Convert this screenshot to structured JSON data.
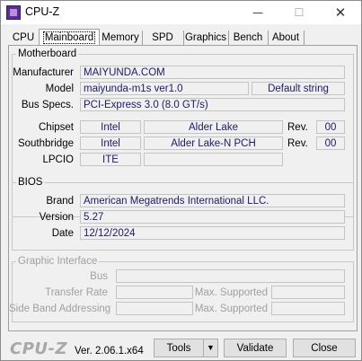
{
  "window": {
    "title": "CPU-Z"
  },
  "tabs": [
    "CPU",
    "Mainboard",
    "Memory",
    "SPD",
    "Graphics",
    "Bench",
    "About"
  ],
  "selected_tab": "Mainboard",
  "motherboard": {
    "legend": "Motherboard",
    "manufacturer_label": "Manufacturer",
    "manufacturer": "MAIYUNDA.COM",
    "model_label": "Model",
    "model": "maiyunda-m1s ver1.0",
    "model_extra": "Default string",
    "bus_label": "Bus Specs.",
    "bus": "PCI-Express 3.0 (8.0 GT/s)",
    "chipset_label": "Chipset",
    "chipset_vendor": "Intel",
    "chipset_name": "Alder Lake",
    "chipset_rev_label": "Rev.",
    "chipset_rev": "00",
    "southbridge_label": "Southbridge",
    "southbridge_vendor": "Intel",
    "southbridge_name": "Alder Lake-N PCH",
    "southbridge_rev_label": "Rev.",
    "southbridge_rev": "00",
    "lpcio_label": "LPCIO",
    "lpcio_vendor": "ITE",
    "lpcio_name": ""
  },
  "bios": {
    "legend": "BIOS",
    "brand_label": "Brand",
    "brand": "American Megatrends International LLC.",
    "version_label": "Version",
    "version": "5.27",
    "date_label": "Date",
    "date": "12/12/2024"
  },
  "graphic_interface": {
    "legend": "Graphic Interface",
    "bus_label": "Bus",
    "transfer_rate_label": "Transfer Rate",
    "max_supported_label_1": "Max. Supported",
    "side_band_label": "Side Band Addressing",
    "max_supported_label_2": "Max. Supported"
  },
  "footer": {
    "logo": "CPU-Z",
    "version": "Ver. 2.06.1.x64",
    "tools_label": "Tools",
    "validate_label": "Validate",
    "close_label": "Close"
  }
}
